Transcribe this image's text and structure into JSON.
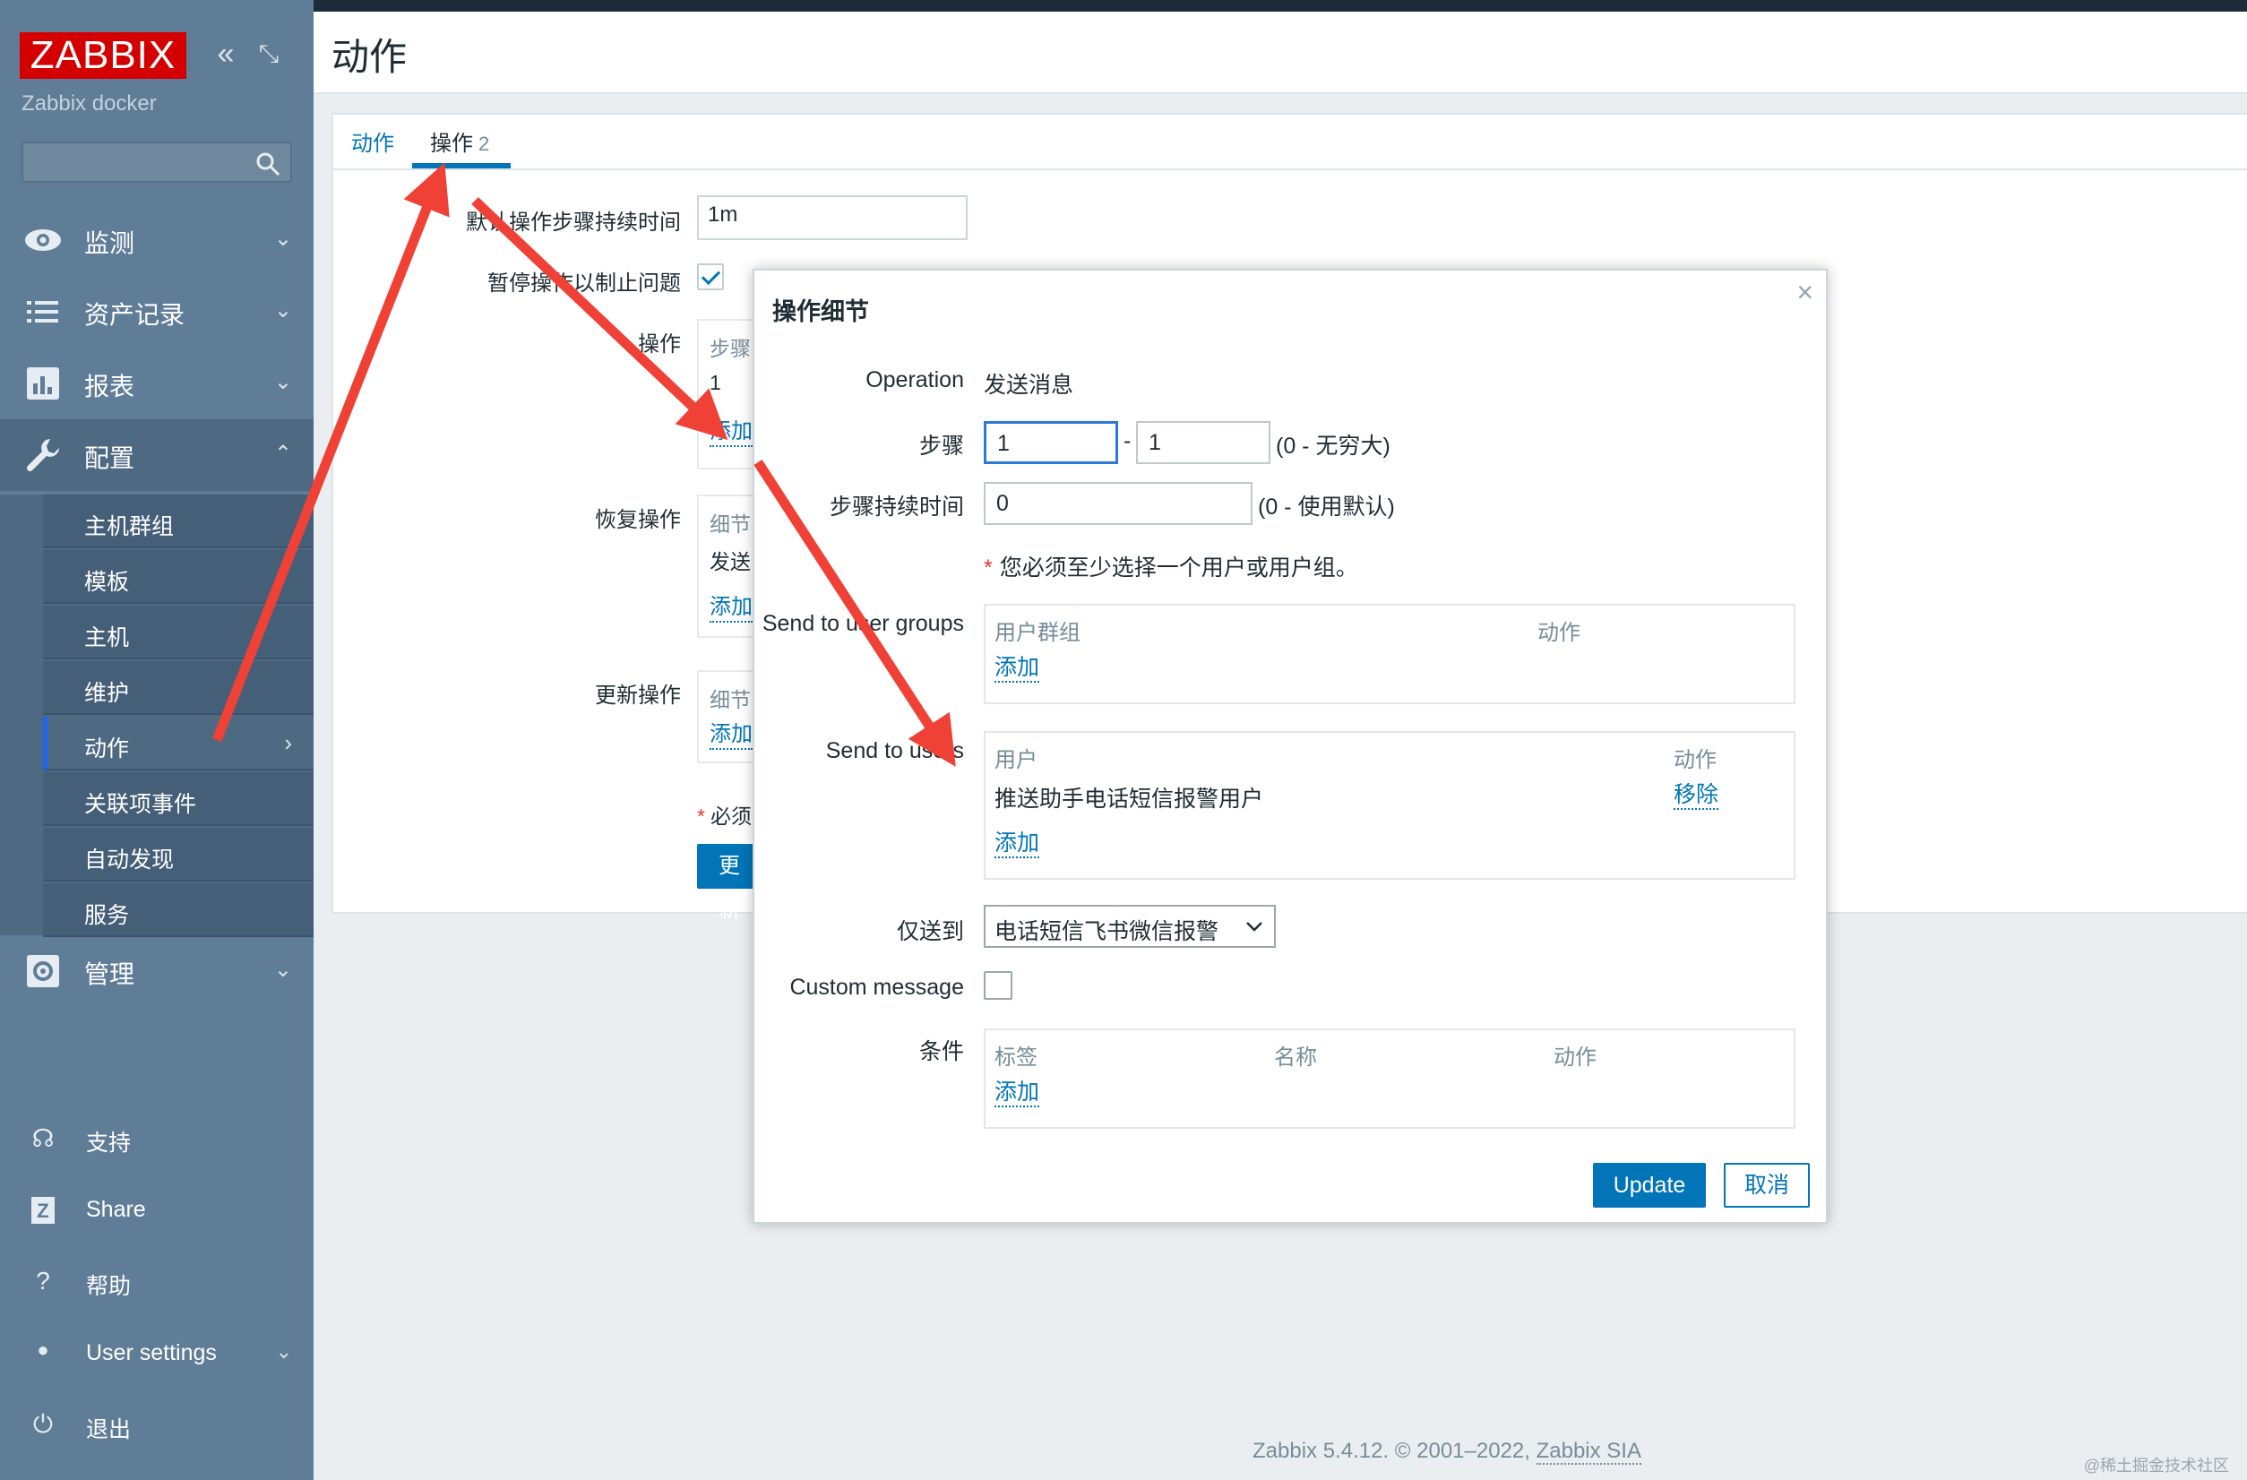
{
  "sidebar": {
    "logo": "ZABBIX",
    "server_name": "Zabbix docker",
    "collapse_glyph": "«",
    "kiosk_glyph": "⤡",
    "menu": [
      {
        "label": "监测",
        "icon": "eye-icon",
        "caret": "⌄"
      },
      {
        "label": "资产记录",
        "icon": "list-icon",
        "caret": "⌄"
      },
      {
        "label": "报表",
        "icon": "bar-chart-icon",
        "caret": "⌄"
      },
      {
        "label": "配置",
        "icon": "wrench-icon",
        "caret": "⌃"
      },
      {
        "label": "管理",
        "icon": "gear-icon",
        "caret": "⌄"
      }
    ],
    "submenu": [
      "主机群组",
      "模板",
      "主机",
      "维护",
      "动作",
      "关联项事件",
      "自动发现",
      "服务"
    ],
    "submenu_chevron": "›",
    "bottom": [
      {
        "label": "支持",
        "icon": "headset-icon",
        "glyph": "☊"
      },
      {
        "label": "Share",
        "icon": "share-icon",
        "glyph": "Z"
      },
      {
        "label": "帮助",
        "icon": "help-icon",
        "glyph": "?"
      },
      {
        "label": "User settings",
        "icon": "user-icon",
        "glyph": "●",
        "caret": "⌄"
      },
      {
        "label": "退出",
        "icon": "power-icon",
        "glyph": "⏻"
      }
    ]
  },
  "page": {
    "title": "动作",
    "tabs": [
      {
        "label": "动作"
      },
      {
        "label": "操作",
        "count": "2"
      }
    ],
    "form": {
      "default_step_duration_label": "默认操作步骤持续时间",
      "default_step_duration_value": "1m",
      "pause_label": "暂停操作以制止问题",
      "pause_checked": true,
      "operations_label": "操作",
      "operations_col_steps": "步骤",
      "operations_row_step": "1",
      "operations_add": "添加",
      "recovery_label": "恢复操作",
      "recovery_col_details": "细节",
      "recovery_row": "发送",
      "recovery_add": "添加",
      "update_label": "更新操作",
      "update_col_details": "细节",
      "update_add": "添加",
      "required_note": "必须",
      "update_button": "更新"
    },
    "footer": {
      "text": "Zabbix 5.4.12. © 2001–2022,",
      "link": "Zabbix SIA"
    },
    "watermark": "@稀土掘金技术社区"
  },
  "modal": {
    "title": "操作细节",
    "close_glyph": "×",
    "operation_label": "Operation",
    "operation_value": "发送消息",
    "steps_label": "步骤",
    "steps_from": "1",
    "steps_sep": "-",
    "steps_to": "1",
    "steps_hint": "(0 - 无穷大)",
    "step_duration_label": "步骤持续时间",
    "step_duration_value": "0",
    "step_duration_hint": "(0 - 使用默认)",
    "required_msg": "您必须至少选择一个用户或用户组。",
    "send_groups_label": "Send to user groups",
    "groups_col_group": "用户群组",
    "groups_col_action": "动作",
    "groups_add": "添加",
    "send_users_label": "Send to users",
    "users_col_user": "用户",
    "users_col_action": "动作",
    "users_row_user": "推送助手电话短信报警用户",
    "users_row_remove": "移除",
    "users_add": "添加",
    "send_only_label": "仅送到",
    "send_only_value": "电话短信飞书微信报警",
    "custom_message_label": "Custom message",
    "custom_message_checked": false,
    "conditions_label": "条件",
    "cond_col_label": "标签",
    "cond_col_name": "名称",
    "cond_col_action": "动作",
    "cond_add": "添加",
    "update_button": "Update",
    "cancel_button": "取消"
  },
  "colors": {
    "sidebar_bg": "#607d97",
    "logo_bg": "#d40000",
    "link": "#0275b8",
    "arrow": "#ef4136"
  }
}
